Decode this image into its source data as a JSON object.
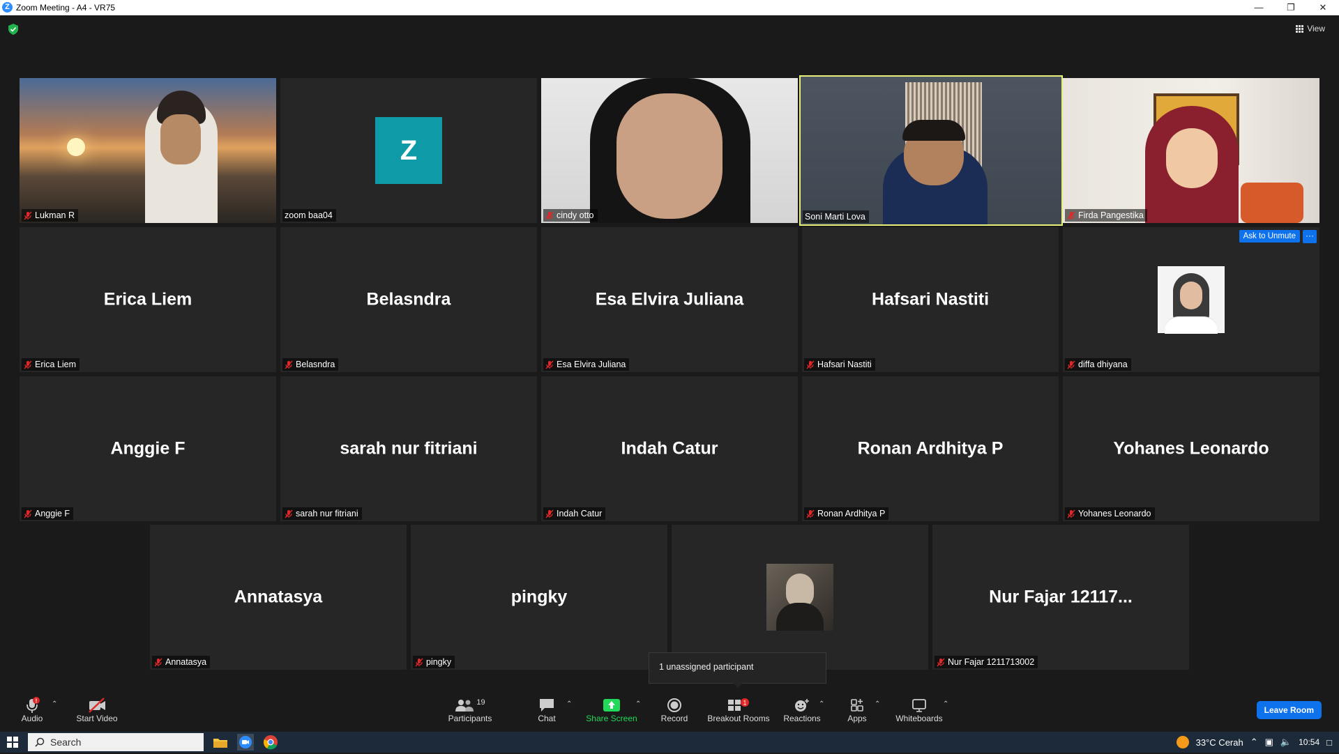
{
  "window": {
    "title": "Zoom Meeting - A4 - VR75",
    "logo": "Z"
  },
  "view_label": "View",
  "tiles": [
    {
      "name": "Lukman R"
    },
    {
      "name": "zoom baa04",
      "avatar_letter": "Z"
    },
    {
      "name": "cindy otto"
    },
    {
      "name": "Soni Marti Lova"
    },
    {
      "name": "Firda Pangestika"
    },
    {
      "name": "Erica Liem",
      "big": "Erica Liem"
    },
    {
      "name": "Belasndra",
      "big": "Belasndra"
    },
    {
      "name": "Esa Elvira Juliana",
      "big": "Esa Elvira Juliana"
    },
    {
      "name": "Hafsari Nastiti",
      "big": "Hafsari Nastiti"
    },
    {
      "name": "diffa dhiyana"
    },
    {
      "name": "Anggie F",
      "big": "Anggie F"
    },
    {
      "name": "sarah nur fitriani",
      "big": "sarah nur fitriani"
    },
    {
      "name": "Indah Catur",
      "big": "Indah Catur"
    },
    {
      "name": "Ronan Ardhitya P",
      "big": "Ronan Ardhitya P"
    },
    {
      "name": "Yohanes Leonardo",
      "big": "Yohanes Leonardo"
    },
    {
      "name": "Annatasya",
      "big": "Annatasya"
    },
    {
      "name": "pingky",
      "big": "pingky"
    },
    {
      "name": ""
    },
    {
      "name": "Nur Fajar 1211713002",
      "big": "Nur Fajar 12117..."
    }
  ],
  "ask_to_unmute": "Ask to Unmute",
  "more_label": "···",
  "tooltip": "1 unassigned participant",
  "toolbar": {
    "audio": "Audio",
    "start_video": "Start Video",
    "participants": "Participants",
    "participants_count": "19",
    "chat": "Chat",
    "share_screen": "Share Screen",
    "record": "Record",
    "breakout_rooms": "Breakout Rooms",
    "breakout_badge": "1",
    "reactions": "Reactions",
    "apps": "Apps",
    "whiteboards": "Whiteboards",
    "leave": "Leave Room",
    "audio_badge": "!"
  },
  "taskbar": {
    "search": "Search",
    "weather": "33°C  Cerah",
    "time": "10:54"
  },
  "colors": {
    "accent": "#0e72ed",
    "active_speaker": "#e9f07a",
    "avatar_teal": "#0e9aa7",
    "share_green": "#23d959",
    "badge_red": "#e02828"
  }
}
